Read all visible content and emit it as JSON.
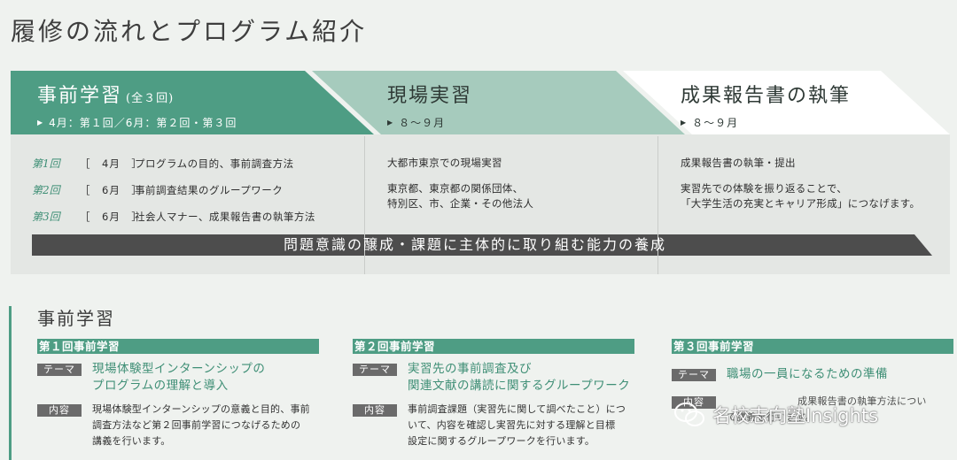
{
  "page": {
    "title": "履修の流れとプログラム紹介"
  },
  "flow": {
    "stage1": {
      "title": "事前学習",
      "note": "(全３回)",
      "schedule": "4月：第１回／6月：第２回・第３回"
    },
    "stage2": {
      "title": "現場実習",
      "schedule": "８〜９月"
    },
    "stage3": {
      "title": "成果報告書の執筆",
      "schedule": "８〜９月"
    },
    "sessions": [
      {
        "no": "第1回",
        "month": "［　4月　］",
        "desc": "プログラムの目的、事前調査方法"
      },
      {
        "no": "第2回",
        "month": "［　6月　］",
        "desc": "事前調査結果のグループワーク"
      },
      {
        "no": "第3回",
        "month": "［　6月　］",
        "desc": "社会人マナー、成果報告書の執筆方法"
      }
    ],
    "stage2_body": {
      "line1": "大都市東京での現場実習",
      "line2": "東京都、東京都の関係団体、",
      "line3": "特別区、市、企業・その他法人"
    },
    "stage3_body": {
      "line1": "成果報告書の執筆・提出",
      "line2": "実習先での体験を振り返ることで、",
      "line3": "「大学生活の充実とキャリア形成」につなげます。"
    },
    "banner": "問題意識の醸成・課題に主体的に取り組む能力の養成"
  },
  "section": {
    "title": "事前学習"
  },
  "cards": [
    {
      "head": "第１回事前学習",
      "theme_tag": "テーマ",
      "theme": [
        "現場体験型インターンシップの",
        "プログラムの理解と導入"
      ],
      "content_tag": "内容",
      "content": [
        "現場体験型インターンシップの意義と目的、事前",
        "調査方法など第２回事前学習につなげるための",
        "講義を行います。"
      ]
    },
    {
      "head": "第２回事前学習",
      "theme_tag": "テーマ",
      "theme": [
        "実習先の事前調査及び",
        "関連文献の講読に関するグループワーク"
      ],
      "content_tag": "内容",
      "content": [
        "事前調査課題（実習先に関して調べたこと）につ",
        "いて、内容を確認し実習先に対する理解と目標",
        "設定に関するグループワークを行います。"
      ]
    },
    {
      "head": "第３回事前学習",
      "theme_tag": "テーマ",
      "theme": [
        "職場の一員になるための準備"
      ],
      "content_tag": "内容",
      "content": [
        "成果報告書の執筆方法につい",
        "て講義を行います。"
      ]
    }
  ],
  "watermark": {
    "text": "名校志向塾Insights",
    "icon": "wechat-icon"
  },
  "colors": {
    "accent": "#4e9d84",
    "accent_light": "#a6cbbd",
    "arrow_dark": "#4d4d4d"
  }
}
